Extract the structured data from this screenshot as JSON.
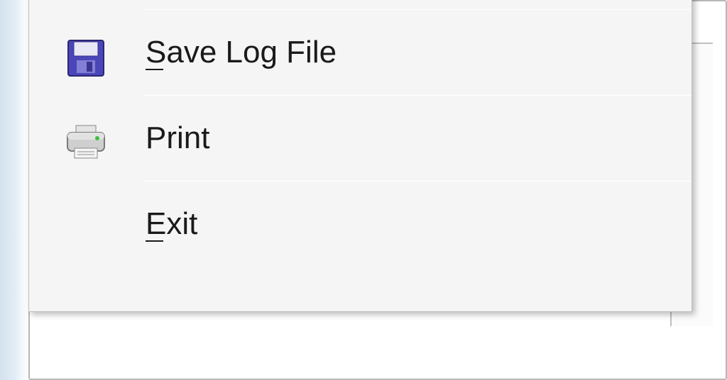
{
  "menu": {
    "items": [
      {
        "label": "Save Log File"
      },
      {
        "label": "Print"
      },
      {
        "label": "Exit"
      }
    ]
  }
}
